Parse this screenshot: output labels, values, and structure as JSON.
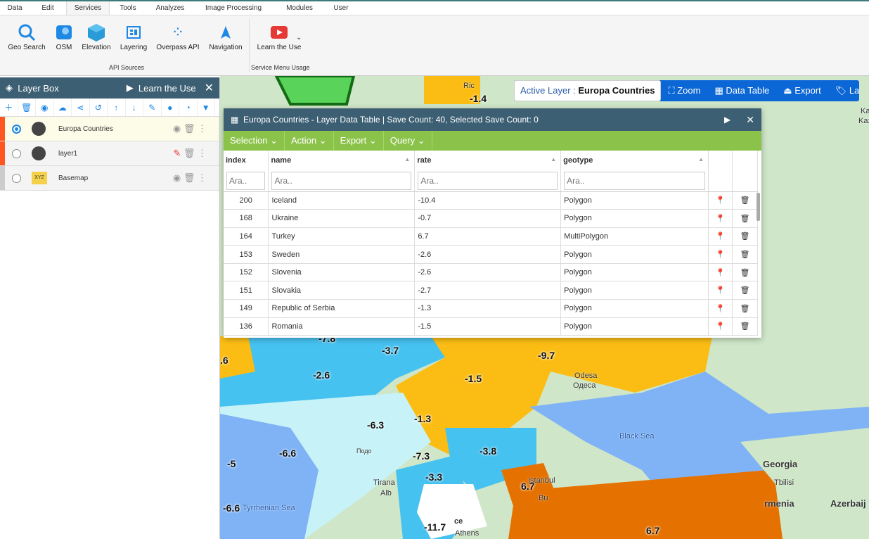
{
  "menu_tabs": [
    "Data",
    "Edit",
    "Services",
    "Tools",
    "Analyzes",
    "Image Processing",
    "Modules",
    "User"
  ],
  "active_tab": "Services",
  "ribbon": {
    "buttons": [
      {
        "label": "Geo Search",
        "icon": "search-icon"
      },
      {
        "label": "OSM",
        "icon": "osm-icon"
      },
      {
        "label": "Elevation",
        "icon": "cube-icon"
      },
      {
        "label": "Layering",
        "icon": "layering-icon"
      },
      {
        "label": "Overpass API",
        "icon": "overpass-icon"
      },
      {
        "label": "Navigation",
        "icon": "navigation-icon"
      },
      {
        "label": "Learn the Use",
        "icon": "youtube-icon"
      }
    ],
    "groups": [
      "API Sources",
      "Service Menu Usage"
    ]
  },
  "layer_box": {
    "title": "Layer Box",
    "learn": "Learn the Use",
    "layers": [
      {
        "name": "Europa Countries",
        "selected": true,
        "color": "#ff5722"
      },
      {
        "name": "layer1",
        "selected": false,
        "color": "#ff5722"
      },
      {
        "name": "Basemap",
        "selected": false,
        "color": "#ccc",
        "badge": "XYZ"
      }
    ]
  },
  "map_toolbar": {
    "active_prefix": "Active Layer :",
    "active_name": "Europa Countries",
    "zoom": "Zoom",
    "data_table": "Data Table",
    "export": "Export",
    "label": "La"
  },
  "dialog": {
    "title": "Europa Countries - Layer Data Table | Save Count: 40, Selected Save Count: 0",
    "menus": [
      "Selection",
      "Action",
      "Export",
      "Query"
    ],
    "columns": [
      "index",
      "name",
      "rate",
      "geotype"
    ],
    "filter_placeholder": "Ara..",
    "rows": [
      [
        "200",
        "Iceland",
        "-10.4",
        "Polygon"
      ],
      [
        "168",
        "Ukraine",
        "-0.7",
        "Polygon"
      ],
      [
        "164",
        "Turkey",
        "6.7",
        "MultiPolygon"
      ],
      [
        "153",
        "Sweden",
        "-2.6",
        "Polygon"
      ],
      [
        "152",
        "Slovenia",
        "-2.6",
        "Polygon"
      ],
      [
        "151",
        "Slovakia",
        "-2.7",
        "Polygon"
      ],
      [
        "149",
        "Republic of Serbia",
        "-1.3",
        "Polygon"
      ],
      [
        "136",
        "Romania",
        "-1.5",
        "Polygon"
      ]
    ]
  },
  "map_labels": {
    "values": [
      "-1.4",
      "-7.8",
      ".6",
      "-3.7",
      "-9.7",
      "-2.6",
      "-1.5",
      "-6.3",
      "-1.3",
      "-6.6",
      "-5",
      "-7.3",
      "-3.8",
      "-3.3",
      "6.7",
      "-6.6",
      "-11.7",
      "6.7"
    ],
    "places": [
      "Ric",
      "Black Sea",
      "Georgia",
      "Tbilisi",
      "rmenia",
      "Azerbaij",
      "Tirana",
      "Alb",
      "Tyrrhenian Sea",
      "Istanbul",
      "Athens",
      "Odesa",
      "Одеса",
      "Ka",
      "Kaз",
      "Bu",
      "ce",
      "Подо"
    ]
  }
}
